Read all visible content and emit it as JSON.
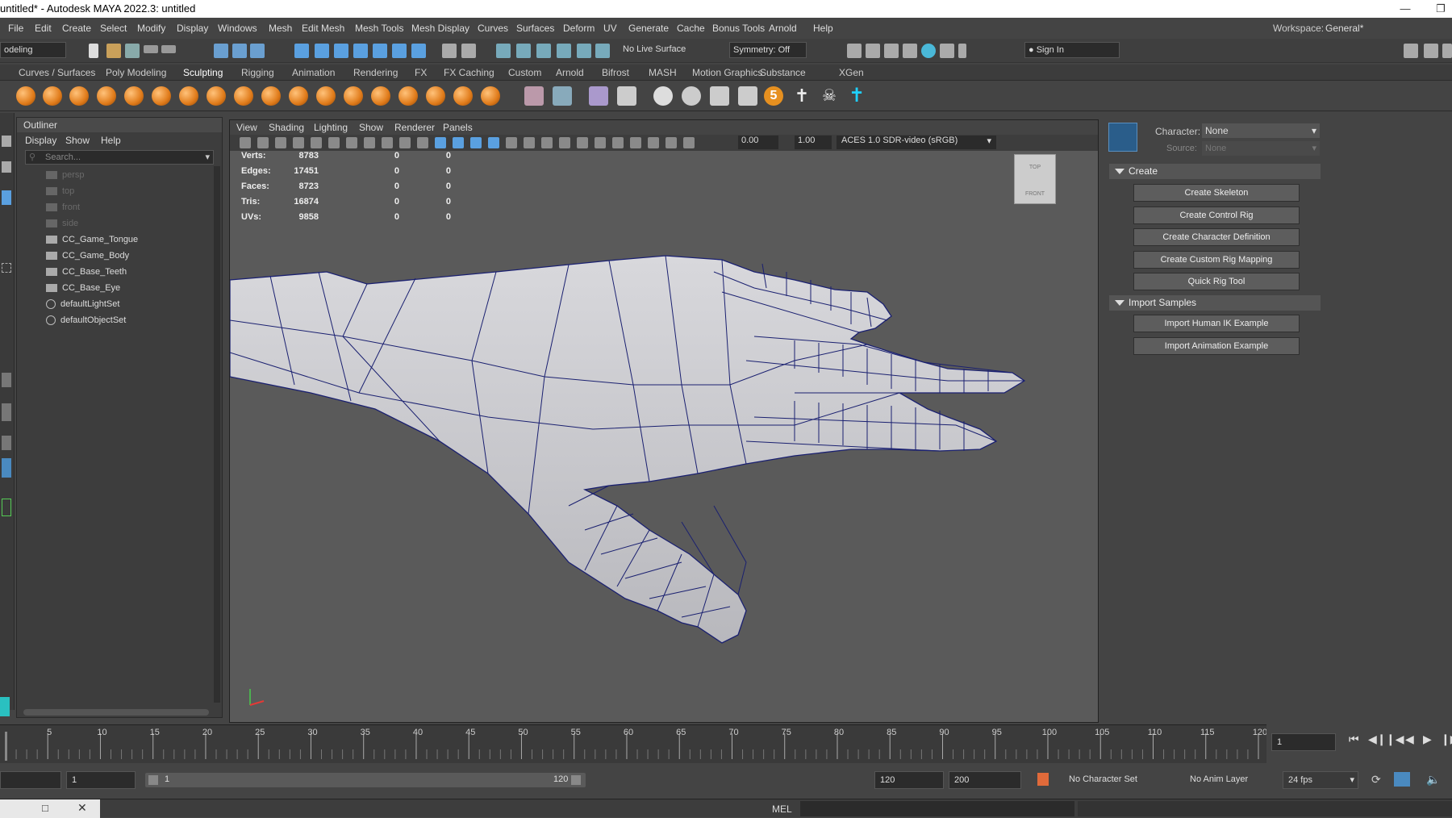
{
  "window": {
    "title": "untitled* - Autodesk MAYA 2022.3: untitled",
    "workspace_label": "Workspace:",
    "workspace_value": "General*"
  },
  "menu": [
    "File",
    "Edit",
    "Create",
    "Select",
    "Modify",
    "Display",
    "Windows",
    "Mesh",
    "Edit Mesh",
    "Mesh Tools",
    "Mesh Display",
    "Curves",
    "Surfaces",
    "Deform",
    "UV",
    "Generate",
    "Cache",
    "Bonus Tools",
    "Arnold",
    "Help"
  ],
  "toolbar": {
    "mode": "odeling",
    "live_surface": "No Live Surface",
    "symmetry": "Symmetry: Off",
    "sign_in": "Sign In"
  },
  "shelf_tabs": [
    "Curves / Surfaces",
    "Poly Modeling",
    "Sculpting",
    "Rigging",
    "Animation",
    "Rendering",
    "FX",
    "FX Caching",
    "Custom",
    "Arnold",
    "Bifrost",
    "MASH",
    "Motion Graphics",
    "Substance",
    "XGen"
  ],
  "outliner": {
    "title": "Outliner",
    "menus": [
      "Display",
      "Show",
      "Help"
    ],
    "search_placeholder": "Search...",
    "items": [
      {
        "label": "persp",
        "dim": true
      },
      {
        "label": "top",
        "dim": true
      },
      {
        "label": "front",
        "dim": true
      },
      {
        "label": "side",
        "dim": true
      },
      {
        "label": "CC_Game_Tongue",
        "dim": false
      },
      {
        "label": "CC_Game_Body",
        "dim": false
      },
      {
        "label": "CC_Base_Teeth",
        "dim": false
      },
      {
        "label": "CC_Base_Eye",
        "dim": false
      },
      {
        "label": "defaultLightSet",
        "dim": false
      },
      {
        "label": "defaultObjectSet",
        "dim": false
      }
    ]
  },
  "viewport": {
    "menus": [
      "View",
      "Shading",
      "Lighting",
      "Show",
      "Renderer",
      "Panels"
    ],
    "exposure": "0.00",
    "gamma": "1.00",
    "color_space": "ACES 1.0 SDR-video (sRGB)",
    "hud": [
      {
        "label": "Verts:",
        "a": "8783",
        "b": "0",
        "c": "0"
      },
      {
        "label": "Edges:",
        "a": "17451",
        "b": "0",
        "c": "0"
      },
      {
        "label": "Faces:",
        "a": "8723",
        "b": "0",
        "c": "0"
      },
      {
        "label": "Tris:",
        "a": "16874",
        "b": "0",
        "c": "0"
      },
      {
        "label": "UVs:",
        "a": "9858",
        "b": "0",
        "c": "0"
      }
    ],
    "viewcube_top": "TOP",
    "viewcube_front": "FRONT"
  },
  "character_panel": {
    "character_label": "Character:",
    "character_value": "None",
    "source_label": "Source:",
    "source_value": "None",
    "create_section": "Create",
    "create_buttons": [
      "Create Skeleton",
      "Create Control Rig",
      "Create Character Definition",
      "Create Custom Rig Mapping",
      "Quick Rig Tool"
    ],
    "import_section": "Import Samples",
    "import_buttons": [
      "Import Human IK Example",
      "Import Animation Example"
    ]
  },
  "timeline": {
    "ticks": [
      "5",
      "10",
      "15",
      "20",
      "25",
      "30",
      "35",
      "40",
      "45",
      "50",
      "55",
      "60",
      "65",
      "70",
      "75",
      "80",
      "85",
      "90",
      "95",
      "100",
      "105",
      "110",
      "115",
      "120"
    ],
    "current_frame": "1"
  },
  "range": {
    "start": "1",
    "inner_start": "1",
    "inner_end": "120",
    "end": "120",
    "max": "200",
    "character_set": "No Character Set",
    "anim_layer": "No Anim Layer",
    "fps": "24 fps"
  },
  "command": {
    "mel_label": "MEL"
  }
}
